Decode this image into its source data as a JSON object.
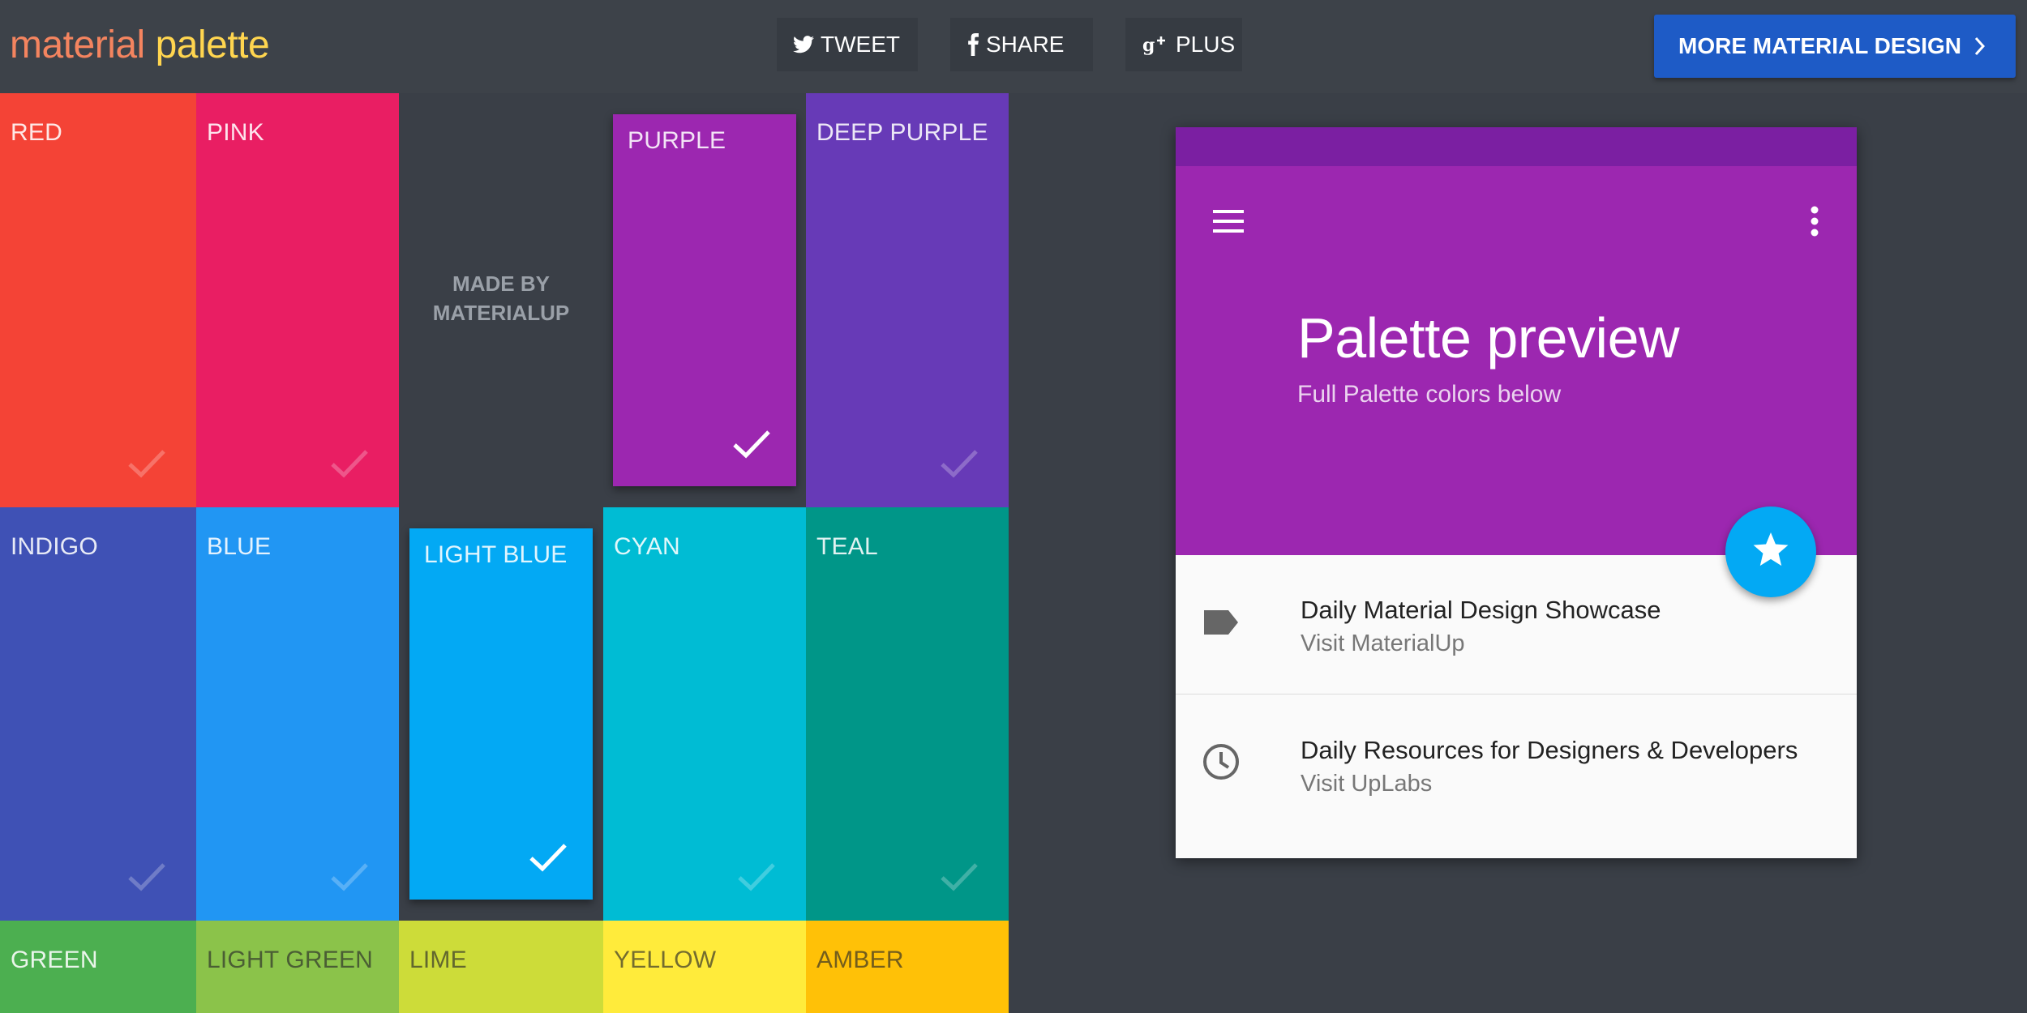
{
  "header": {
    "logo_word1": "material",
    "logo_word2": "palette",
    "tweet_label": "TWEET",
    "share_label": "SHARE",
    "plus_label": "PLUS",
    "more_label": "MORE MATERIAL DESIGN",
    "more_color": "#1e5bc6"
  },
  "grid": {
    "made_by": "MADE BY MATERIALUP",
    "tiles": [
      {
        "label": "RED",
        "color": "#f44336"
      },
      {
        "label": "PINK",
        "color": "#e91e63"
      },
      {
        "label": "PURPLE",
        "color": "#9c27b0",
        "selected": true
      },
      {
        "label": "DEEP PURPLE",
        "color": "#673ab7"
      },
      {
        "label": "INDIGO",
        "color": "#3f51b5"
      },
      {
        "label": "BLUE",
        "color": "#2196f3"
      },
      {
        "label": "LIGHT BLUE",
        "color": "#03a9f4",
        "selected": true
      },
      {
        "label": "CYAN",
        "color": "#00bcd4"
      },
      {
        "label": "TEAL",
        "color": "#009688"
      },
      {
        "label": "GREEN",
        "color": "#4caf50"
      },
      {
        "label": "LIGHT GREEN",
        "color": "#8bc34a"
      },
      {
        "label": "LIME",
        "color": "#cddc39"
      },
      {
        "label": "YELLOW",
        "color": "#ffeb3b"
      },
      {
        "label": "AMBER",
        "color": "#ffc107"
      }
    ]
  },
  "preview": {
    "title": "Palette preview",
    "subtitle": "Full Palette colors below",
    "primary_color": "#9c27b0",
    "primary_dark": "#7b1fa2",
    "accent_color": "#03a9f4",
    "items": [
      {
        "title": "Daily Material Design Showcase",
        "subtitle": "Visit MaterialUp",
        "icon": "label-icon"
      },
      {
        "title": "Daily Resources for Designers & Developers",
        "subtitle": "Visit UpLabs",
        "icon": "clock-icon"
      }
    ]
  }
}
